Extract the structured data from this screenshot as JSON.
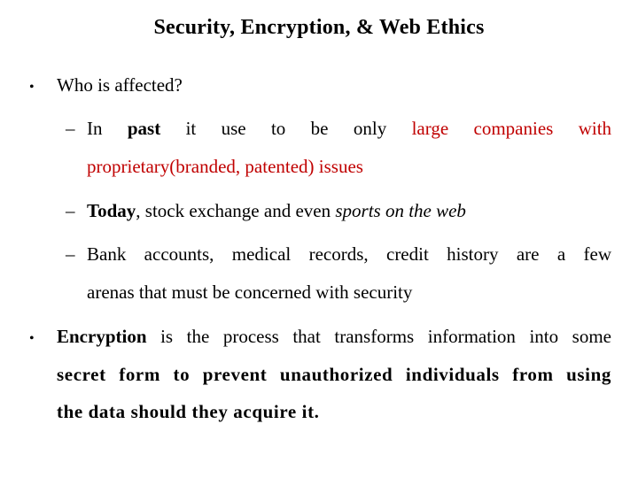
{
  "slide": {
    "title": "Security, Encryption, & Web Ethics",
    "accent_color": "#c00000",
    "bullets": [
      {
        "text": "Who is affected?",
        "sub": [
          {
            "parts": [
              "In",
              "past",
              "it",
              "use",
              "to",
              "be",
              "only",
              "large",
              "companies",
              "with"
            ],
            "cont": "proprietary(branded, patented) issues"
          },
          {
            "bold": "Today",
            "plain": ", stock exchange and even ",
            "italic": "sports on the web"
          },
          {
            "line1": "Bank accounts, medical records, credit history are a few",
            "line2": "arenas that must be concerned with security"
          }
        ]
      },
      {
        "bold": "Encryption",
        "plain": " is the process that transforms information into some",
        "line2": "secret form to prevent unauthorized individuals from using",
        "line3": "the data should they acquire it."
      }
    ]
  }
}
